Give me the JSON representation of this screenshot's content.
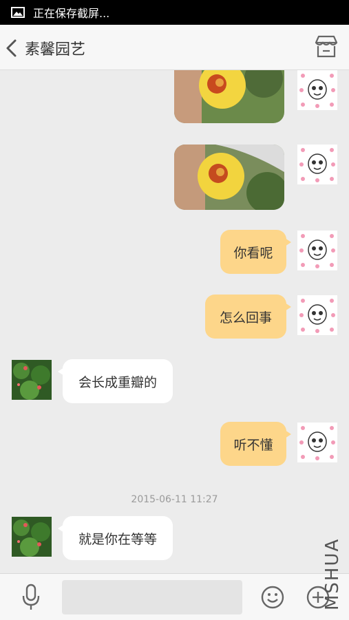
{
  "status_bar": {
    "text": "正在保存截屏...",
    "icon": "image-icon"
  },
  "header": {
    "title": "素馨园艺",
    "back_icon": "chevron-left-icon",
    "right_icon": "store-icon"
  },
  "messages": [
    {
      "side": "mine",
      "type": "image",
      "subject": "yellow flower photo"
    },
    {
      "side": "mine",
      "type": "image",
      "subject": "yellow flower photo"
    },
    {
      "side": "mine",
      "type": "text",
      "text": "你看呢"
    },
    {
      "side": "mine",
      "type": "text",
      "text": "怎么回事"
    },
    {
      "side": "theirs",
      "type": "text",
      "text": "会长成重瓣的"
    },
    {
      "side": "mine",
      "type": "text",
      "text": "听不懂"
    },
    {
      "type": "timestamp",
      "text": "2015-06-11 11:27"
    },
    {
      "side": "theirs",
      "type": "text",
      "text": "就是你在等等"
    }
  ],
  "input_bar": {
    "mic_icon": "microphone-icon",
    "placeholder": "",
    "emoji_icon": "smiley-icon",
    "plus_icon": "plus-circle-icon"
  },
  "watermark": "MSHUA",
  "colors": {
    "my_bubble": "#fdd68a",
    "their_bubble": "#ffffff",
    "background": "#ececec"
  }
}
